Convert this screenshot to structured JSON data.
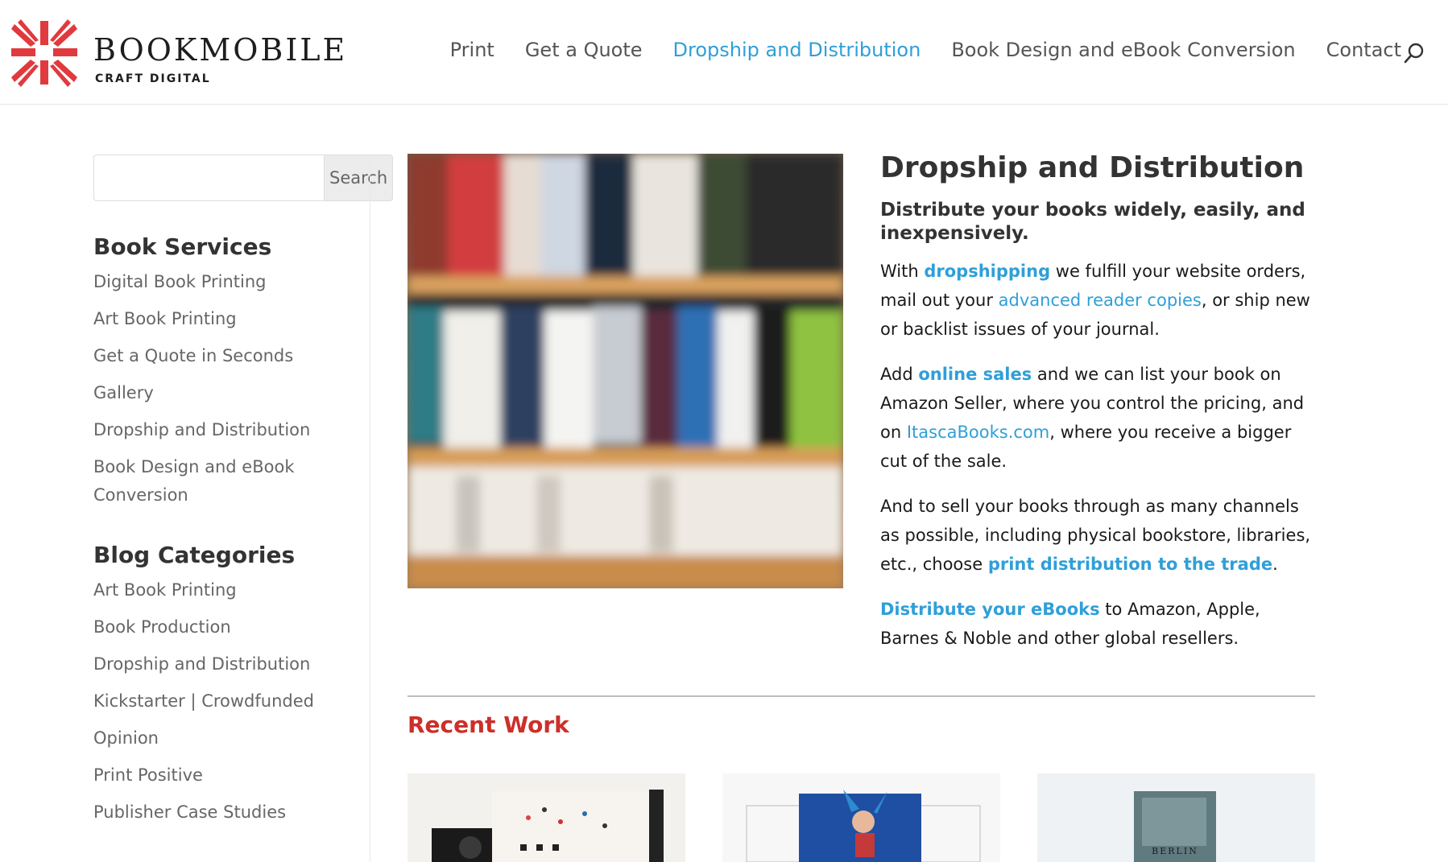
{
  "brand": {
    "name": "BOOKMOBILE",
    "tagline": "CRAFT DIGITAL",
    "accent": "#e03a3e"
  },
  "nav": {
    "items": [
      "Print",
      "Get a Quote",
      "Dropship and Distribution",
      "Book Design and eBook Conversion",
      "Contact"
    ],
    "active_index": 2,
    "active_color": "#2f9fd8"
  },
  "sidebar": {
    "search": {
      "placeholder": "",
      "button_label": "Search"
    },
    "book_services": {
      "heading": "Book Services",
      "items": [
        "Digital Book Printing",
        "Art Book Printing",
        "Get a Quote in Seconds",
        "Gallery",
        "Dropship and Distribution",
        "Book Design and eBook Conversion"
      ]
    },
    "blog_categories": {
      "heading": "Blog Categories",
      "items": [
        "Art Book Printing",
        "Book Production",
        "Dropship and Distribution",
        "Kickstarter | Crowdfunded",
        "Opinion",
        "Print Positive",
        "Publisher Case Studies"
      ]
    }
  },
  "main": {
    "title": "Dropship and Distribution",
    "subtitle": "Distribute your books widely, easily, and inexpensively.",
    "p1": {
      "pre": "With ",
      "link1": "dropshipping",
      "mid": " we fulfill your website orders, mail out your ",
      "link2": "advanced reader copies",
      "post": ", or ship new or backlist issues of your journal."
    },
    "p2": {
      "pre": "Add ",
      "link1": "online sales",
      "mid": " and we can list your book on Amazon Seller, where you control the pricing, and on ",
      "link2": "ItascaBooks.com",
      "post": ", where you receive a bigger cut of the sale."
    },
    "p3": {
      "pre": "And to sell your books through as many channels as possible, including physical bookstore, libraries, etc., choose ",
      "link1": "print distribution to the trade",
      "post": "."
    },
    "p4": {
      "link1": "Distribute your eBooks",
      "post": " to Amazon, Apple, Barnes & Noble and other global resellers."
    },
    "recent_heading": "Recent Work",
    "recent_thumb_text": "BERLIN"
  },
  "icons": {
    "search": "search-icon",
    "logo": "bookmobile-logo-icon"
  }
}
